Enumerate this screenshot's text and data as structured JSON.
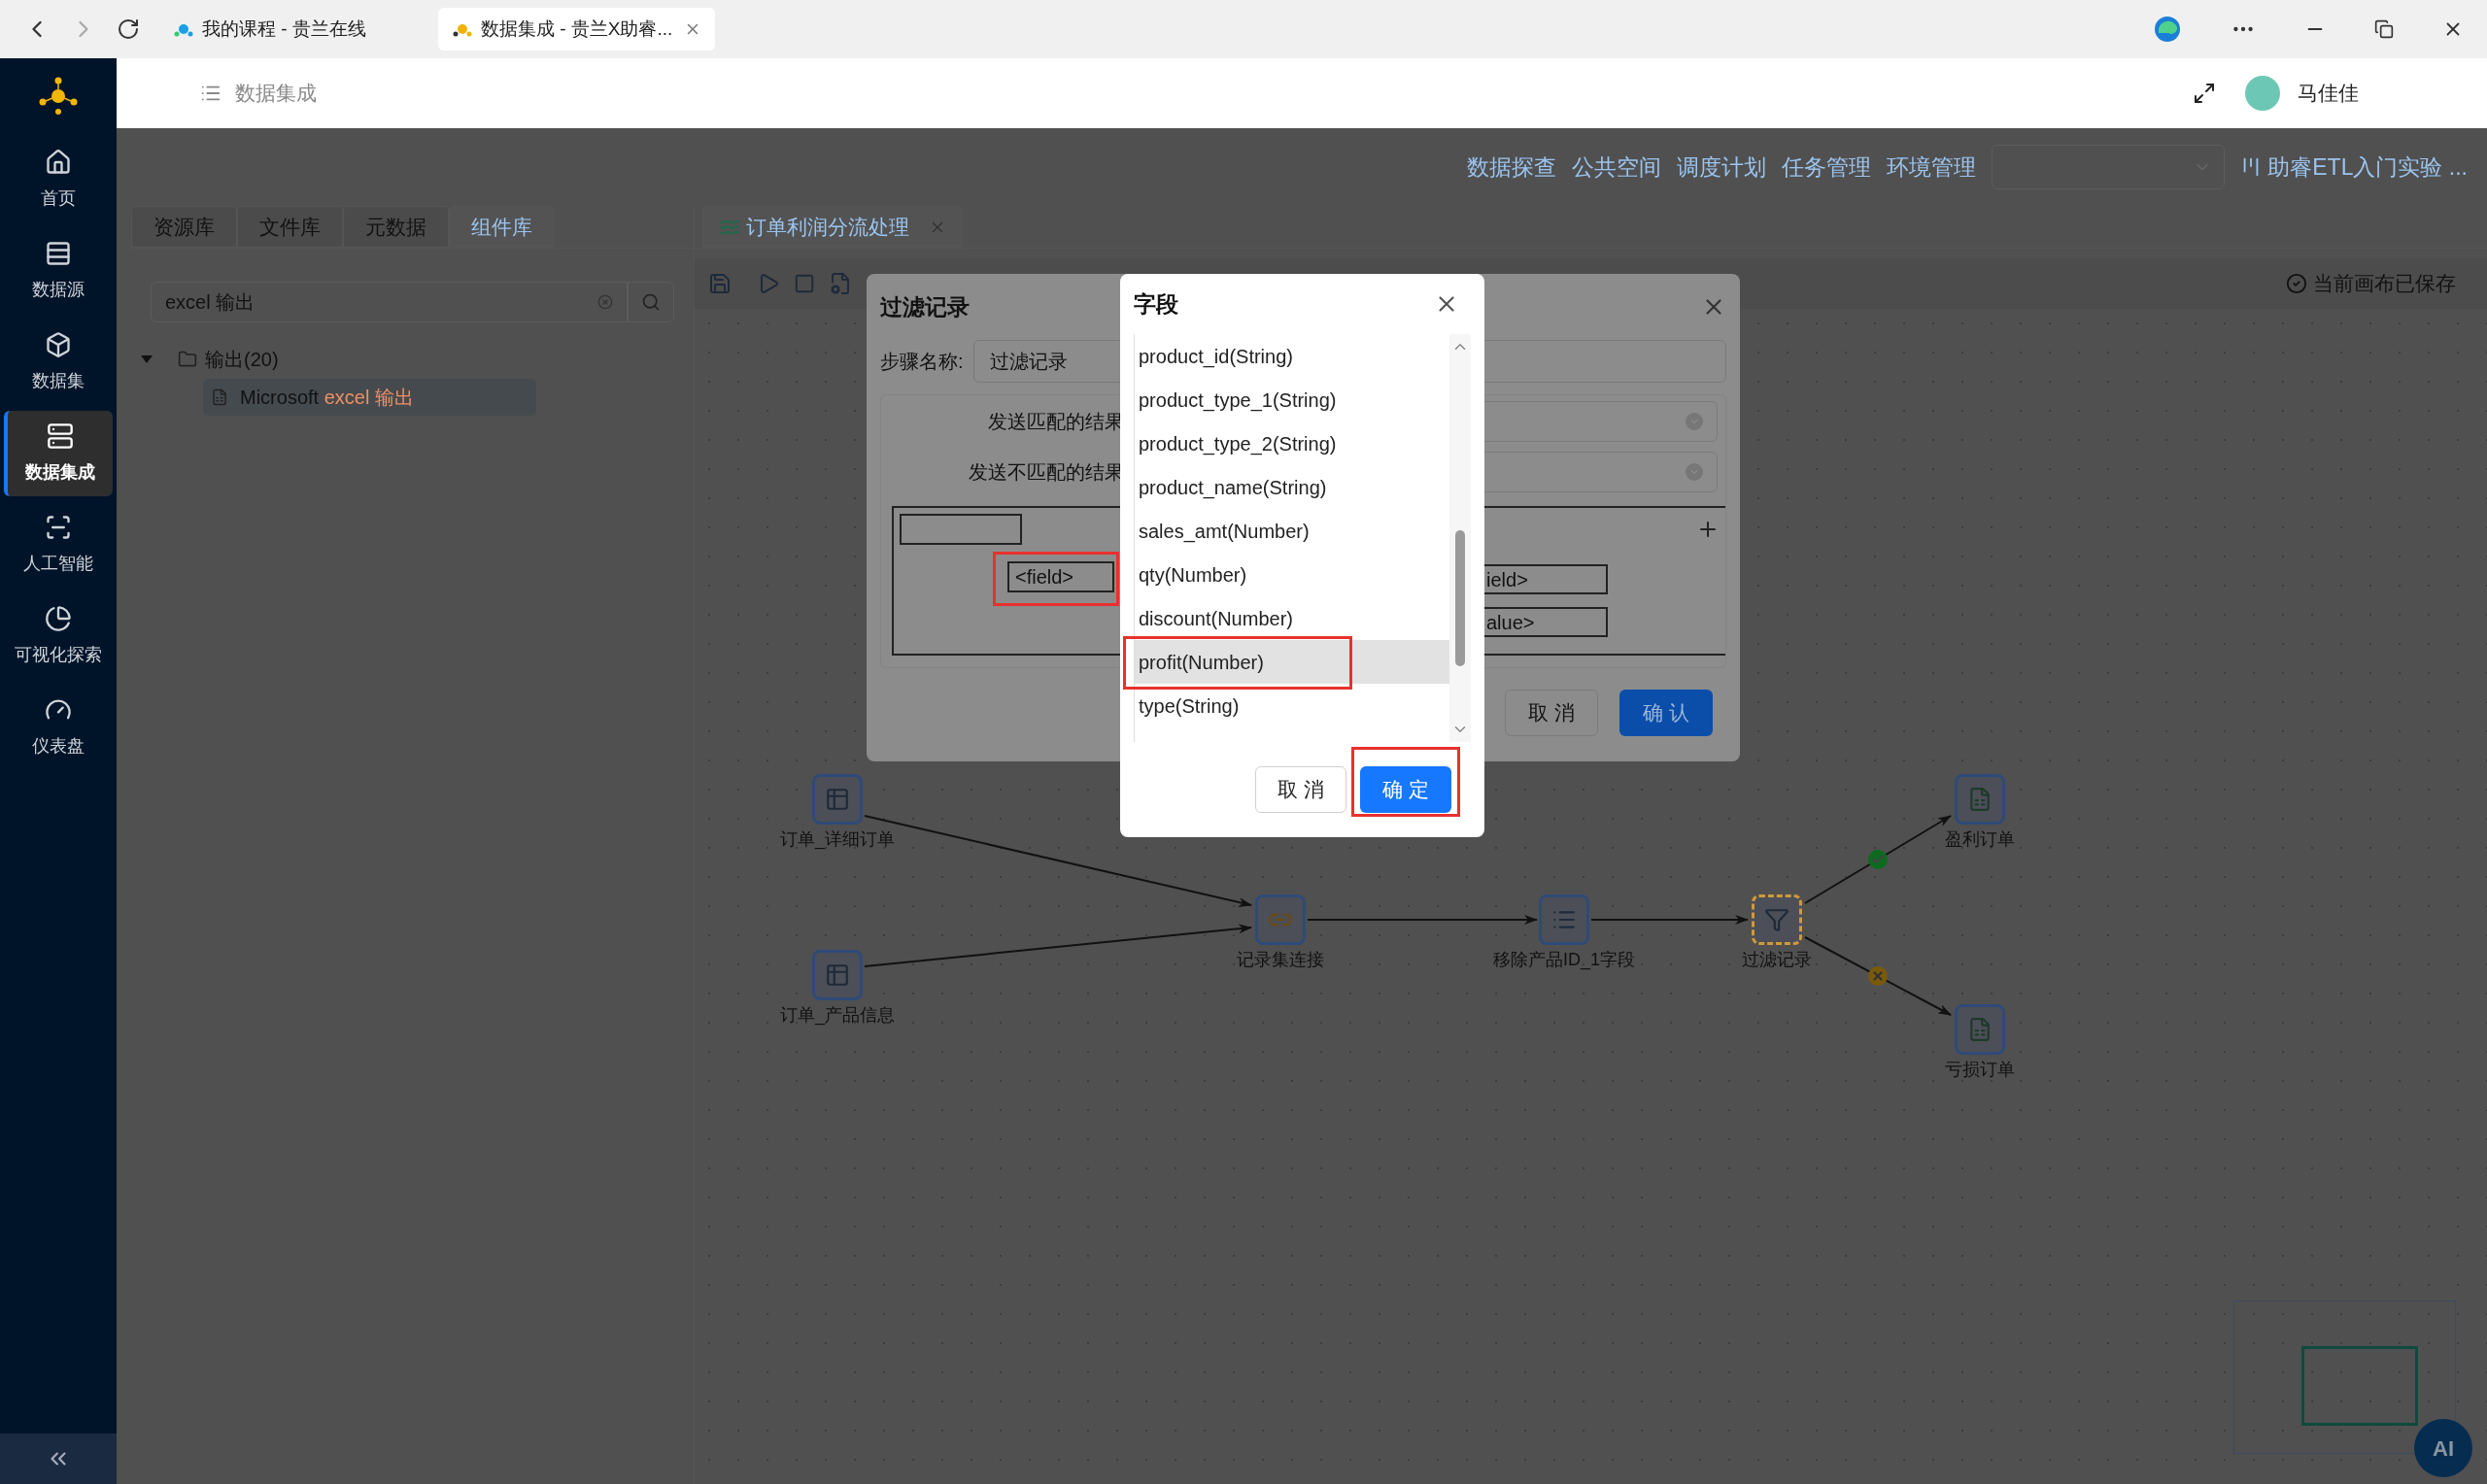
{
  "browser": {
    "tabs": [
      {
        "title": "我的课程 - 贵兰在线",
        "selected": false
      },
      {
        "title": "数据集成 - 贵兰X助睿...",
        "selected": true
      }
    ]
  },
  "sidebar": {
    "items": [
      {
        "label": "首页",
        "selected": false
      },
      {
        "label": "数据源",
        "selected": false
      },
      {
        "label": "数据集",
        "selected": false
      },
      {
        "label": "数据集成",
        "selected": true
      },
      {
        "label": "人工智能",
        "selected": false
      },
      {
        "label": "可视化探索",
        "selected": false
      },
      {
        "label": "仪表盘",
        "selected": false
      }
    ]
  },
  "header": {
    "title": "数据集成",
    "user": "马佳佳"
  },
  "top_nav": {
    "links": [
      "数据探查",
      "公共空间",
      "调度计划",
      "任务管理",
      "环境管理"
    ],
    "project": "助睿ETL入门实验 ..."
  },
  "library": {
    "tabs": [
      {
        "label": "资源库",
        "selected": false
      },
      {
        "label": "文件库",
        "selected": false
      },
      {
        "label": "元数据",
        "selected": false
      },
      {
        "label": "组件库",
        "selected": true
      }
    ],
    "search": {
      "value": "excel 输出"
    },
    "tree": [
      {
        "label": "输出(20)",
        "expanded": true,
        "children": [
          {
            "text": "Microsoft",
            "match": "excel 输出",
            "selected": true
          }
        ]
      }
    ]
  },
  "canvas": {
    "tab": {
      "title": "订单利润分流处理"
    },
    "status": "当前画布已保存",
    "nodes": [
      {
        "label": "订单_详细订单",
        "kind": "input",
        "selected": false
      },
      {
        "label": "订单_产品信息",
        "kind": "input",
        "selected": false
      },
      {
        "label": "记录集连接",
        "kind": "join",
        "selected": false
      },
      {
        "label": "移除产品ID_1字段",
        "kind": "remove",
        "selected": false
      },
      {
        "label": "过滤记录",
        "kind": "filter",
        "selected": true
      },
      {
        "label": "盈利订单",
        "kind": "output",
        "selected": false
      },
      {
        "label": "亏损订单",
        "kind": "output",
        "selected": false
      }
    ],
    "edges": [
      {
        "kind": "plain"
      },
      {
        "kind": "plain"
      },
      {
        "kind": "plain"
      },
      {
        "kind": "plain"
      },
      {
        "kind": "match"
      },
      {
        "kind": "mismatch"
      }
    ]
  },
  "filter_dialog": {
    "title": "过滤记录",
    "step_name_label": "步骤名称:",
    "step_name": "过滤记录",
    "rows": [
      {
        "label": "发送匹配的结果"
      },
      {
        "label": "发送不匹配的结果"
      }
    ],
    "condition": {
      "left_field": "<field>",
      "left_highlighted": true,
      "right_field": "ield>",
      "right_value": "alue>"
    },
    "buttons": [
      {
        "label": "取 消",
        "primary": false
      },
      {
        "label": "确 认",
        "primary": true
      }
    ]
  },
  "field_dialog": {
    "title": "字段",
    "items": [
      {
        "label": "product_id(String)",
        "selected": false,
        "highlighted": false
      },
      {
        "label": "product_type_1(String)",
        "selected": false,
        "highlighted": false
      },
      {
        "label": "product_type_2(String)",
        "selected": false,
        "highlighted": false
      },
      {
        "label": "product_name(String)",
        "selected": false,
        "highlighted": false
      },
      {
        "label": "sales_amt(Number)",
        "selected": false,
        "highlighted": false
      },
      {
        "label": "qty(Number)",
        "selected": false,
        "highlighted": false
      },
      {
        "label": "discount(Number)",
        "selected": false,
        "highlighted": false
      },
      {
        "label": "profit(Number)",
        "selected": true,
        "highlighted": true
      },
      {
        "label": "type(String)",
        "selected": false,
        "highlighted": false
      }
    ],
    "buttons": [
      {
        "label": "取 消",
        "primary": false,
        "highlighted": false
      },
      {
        "label": "确 定",
        "primary": true,
        "highlighted": true
      }
    ]
  },
  "ai_button": "AI"
}
